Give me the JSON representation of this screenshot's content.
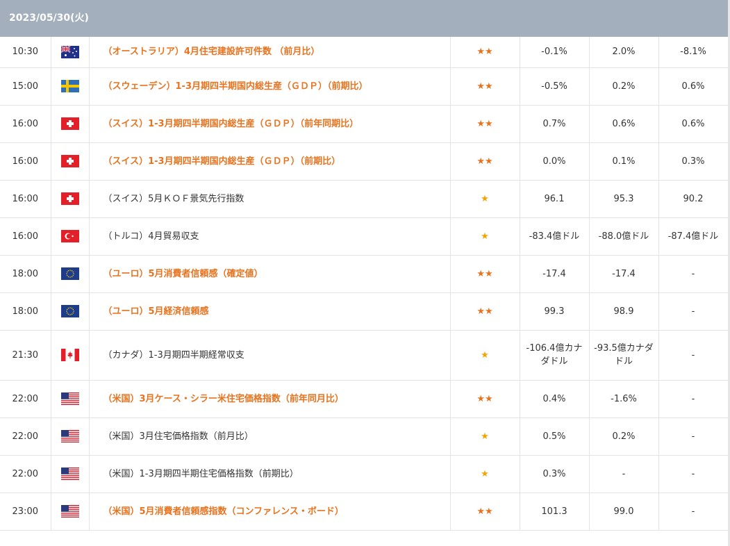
{
  "header": {
    "date": "2023/05/30(火)"
  },
  "rows": [
    {
      "time": "10:30",
      "country": "australia",
      "indicator": "（オーストラリア）4月住宅建設許可件数 （前月比）",
      "important": true,
      "stars": "★★",
      "actual": "-0.1%",
      "forecast": "2.0%",
      "previous": "-8.1%"
    },
    {
      "time": "15:00",
      "country": "sweden",
      "indicator": "（スウェーデン）1-3月期四半期国内総生産（ＧＤＰ）（前期比）",
      "important": true,
      "stars": "★★",
      "actual": "-0.5%",
      "forecast": "0.2%",
      "previous": "0.6%"
    },
    {
      "time": "16:00",
      "country": "switzerland",
      "indicator": "（スイス）1-3月期四半期国内総生産（ＧＤＰ）（前年同期比）",
      "important": true,
      "stars": "★★",
      "actual": "0.7%",
      "forecast": "0.6%",
      "previous": "0.6%"
    },
    {
      "time": "16:00",
      "country": "switzerland",
      "indicator": "（スイス）1-3月期四半期国内総生産（ＧＤＰ）（前期比）",
      "important": true,
      "stars": "★★",
      "actual": "0.0%",
      "forecast": "0.1%",
      "previous": "0.3%"
    },
    {
      "time": "16:00",
      "country": "switzerland",
      "indicator": "（スイス）5月ＫＯＦ景気先行指数",
      "important": false,
      "stars": "★",
      "actual": "96.1",
      "forecast": "95.3",
      "previous": "90.2"
    },
    {
      "time": "16:00",
      "country": "turkey",
      "indicator": "（トルコ）4月貿易収支",
      "important": false,
      "stars": "★",
      "actual": "-83.4億ドル",
      "forecast": "-88.0億ドル",
      "previous": "-87.4億ドル"
    },
    {
      "time": "18:00",
      "country": "eu",
      "indicator": "（ユーロ）5月消費者信頼感（確定値）",
      "important": true,
      "stars": "★★",
      "actual": "-17.4",
      "forecast": "-17.4",
      "previous": "-"
    },
    {
      "time": "18:00",
      "country": "eu",
      "indicator": "（ユーロ）5月経済信頼感",
      "important": true,
      "stars": "★★",
      "actual": "99.3",
      "forecast": "98.9",
      "previous": "-"
    },
    {
      "time": "21:30",
      "country": "canada",
      "indicator": "（カナダ）1-3月期四半期経常収支",
      "important": false,
      "stars": "★",
      "actual": "-106.4億カナダドル",
      "forecast": "-93.5億カナダドル",
      "previous": "-"
    },
    {
      "time": "22:00",
      "country": "usa",
      "indicator": "（米国）3月ケース・シラー米住宅価格指数（前年同月比）",
      "important": true,
      "stars": "★★",
      "actual": "0.4%",
      "forecast": "-1.6%",
      "previous": "-"
    },
    {
      "time": "22:00",
      "country": "usa",
      "indicator": "（米国）3月住宅価格指数（前月比）",
      "important": false,
      "stars": "★",
      "actual": "0.5%",
      "forecast": "0.2%",
      "previous": "-"
    },
    {
      "time": "22:00",
      "country": "usa",
      "indicator": "（米国）1-3月期四半期住宅価格指数（前期比）",
      "important": false,
      "stars": "★",
      "actual": "0.3%",
      "forecast": "-",
      "previous": "-"
    },
    {
      "time": "23:00",
      "country": "usa",
      "indicator": "（米国）5月消費者信頼感指数（コンファレンス・ボード）",
      "important": true,
      "stars": "★★",
      "actual": "101.3",
      "forecast": "99.0",
      "previous": "-"
    }
  ],
  "colors": {
    "header_bg": "#a3afbd",
    "important_text": "#e8731e",
    "star": "#f5a300"
  }
}
